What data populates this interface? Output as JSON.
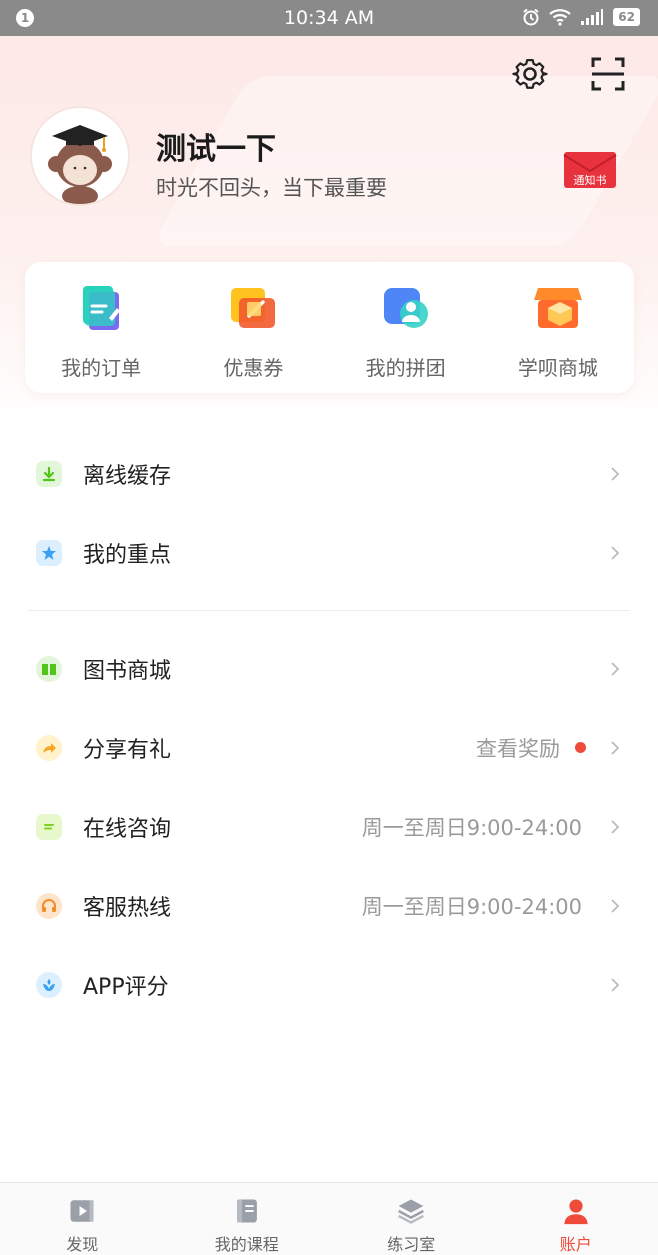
{
  "status_bar": {
    "notification_count": "1",
    "time": "10:34 AM",
    "battery": "62"
  },
  "profile": {
    "name": "测试一下",
    "motto": "时光不回头，当下最重要",
    "notice_label": "通知书"
  },
  "quick_actions": [
    {
      "label": "我的订单",
      "icon": "orders-icon"
    },
    {
      "label": "优惠券",
      "icon": "coupon-icon"
    },
    {
      "label": "我的拼团",
      "icon": "group-buy-icon"
    },
    {
      "label": "学呗商城",
      "icon": "store-icon"
    }
  ],
  "menu": [
    {
      "label": "离线缓存",
      "value": "",
      "icon": "download-icon",
      "color": "#52c41a"
    },
    {
      "label": "我的重点",
      "value": "",
      "icon": "star-icon",
      "color": "#3aa0f2"
    },
    {
      "label": "图书商城",
      "value": "",
      "icon": "book-icon",
      "color": "#52c41a"
    },
    {
      "label": "分享有礼",
      "value": "查看奖励",
      "icon": "share-icon",
      "color": "#f5a623"
    },
    {
      "label": "在线咨询",
      "value": "周一至周日9:00-24:00",
      "icon": "chat-icon",
      "color": "#7ed321"
    },
    {
      "label": "客服热线",
      "value": "周一至周日9:00-24:00",
      "icon": "headset-icon",
      "color": "#f28c28"
    },
    {
      "label": "APP评分",
      "value": "",
      "icon": "rating-icon",
      "color": "#3aa0f2"
    }
  ],
  "tabs": [
    {
      "label": "发现",
      "icon": "discover-icon",
      "active": false
    },
    {
      "label": "我的课程",
      "icon": "courses-icon",
      "active": false
    },
    {
      "label": "练习室",
      "icon": "practice-icon",
      "active": false
    },
    {
      "label": "账户",
      "icon": "account-icon",
      "active": true
    }
  ],
  "colors": {
    "accent": "#ef4a3a",
    "header_bg": "#fde9e6"
  }
}
